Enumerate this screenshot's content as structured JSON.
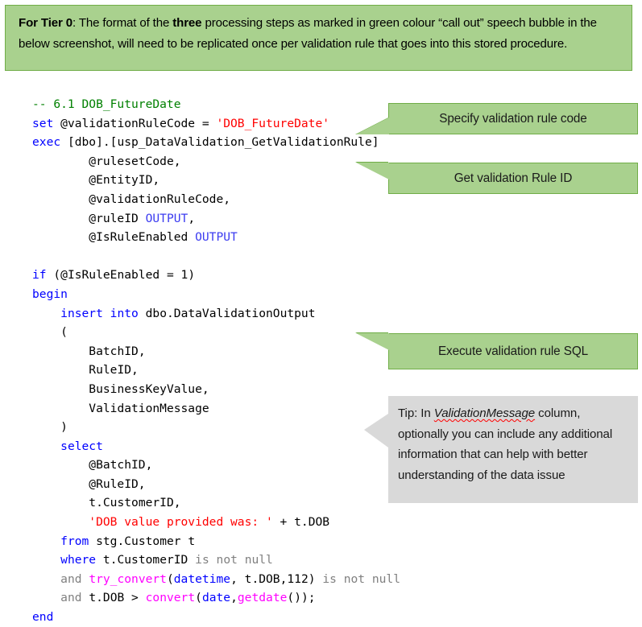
{
  "note": {
    "label_bold": "For Tier 0",
    "text_part_1": ": The format of the ",
    "emphasis": "three",
    "text_part_2": " processing steps as marked in green colour “call out” speech bubble in the below screenshot, will need to be replicated once per validation rule that goes into this stored procedure.",
    "background_color": "#A9D18E",
    "border_color": "#70AD47"
  },
  "code": {
    "language": "T-SQL",
    "lines": [
      "-- 6.1 DOB_FutureDate",
      "set @validationRuleCode = 'DOB_FutureDate'",
      "exec [dbo].[usp_DataValidation_GetValidationRule]",
      "        @rulesetCode,",
      "        @EntityID,",
      "        @validationRuleCode,",
      "        @ruleID OUTPUT,",
      "        @IsRuleEnabled OUTPUT",
      "",
      "if (@IsRuleEnabled = 1)",
      "begin",
      "    insert into dbo.DataValidationOutput",
      "    (",
      "        BatchID,",
      "        RuleID,",
      "        BusinessKeyValue,",
      "        ValidationMessage",
      "    )",
      "    select",
      "        @BatchID,",
      "        @RuleID,",
      "        t.CustomerID,",
      "        'DOB value provided was: ' + t.DOB",
      "    from stg.Customer t",
      "    where t.CustomerID is not null",
      "    and try_convert(datetime, t.DOB,112) is not null",
      "    and t.DOB > convert(date,getdate());",
      "end"
    ],
    "colors": {
      "keyword": "#0000FF",
      "comment": "#008000",
      "string": "#FF0000",
      "operator_gray": "#808080",
      "function": "#FF00FF",
      "output_keyword": "#3C3CF0",
      "identifier": "#000000"
    }
  },
  "callouts": [
    {
      "id": "callout-1",
      "text": "Specify validation rule code",
      "color": "#A9D18E",
      "points_at": "set @validationRuleCode = 'DOB_FutureDate'"
    },
    {
      "id": "callout-2",
      "text": "Get validation Rule ID",
      "color": "#A9D18E",
      "points_at": "exec [dbo].[usp_DataValidation_GetValidationRule]"
    },
    {
      "id": "callout-3",
      "text": "Execute validation rule SQL",
      "color": "#A9D18E",
      "points_at": "insert into dbo.DataValidationOutput"
    }
  ],
  "tip": {
    "prefix": "Tip: In ",
    "column_name": "ValidationMessage",
    "suffix": " column, optionally you can include any additional information that can help with better understanding of the data issue",
    "background_color": "#D9D9D9"
  }
}
